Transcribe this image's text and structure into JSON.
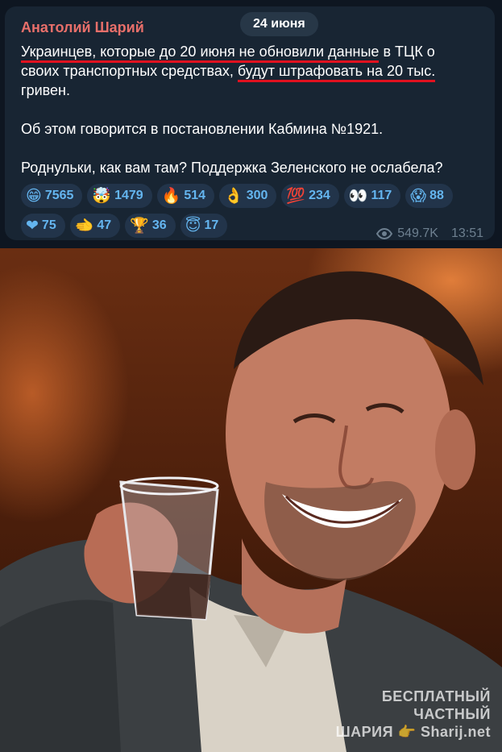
{
  "post": {
    "date": "24 июня",
    "author": "Анатолий Шарий",
    "text": {
      "l1_u1": "Украинцев, которые до 20 июня не обновили данные",
      "l1_rest": " в ТЦК о",
      "l2_pre": "своих транспортных средствах, ",
      "l2_u2": "будут штрафовать на 20 тыс.",
      "l3": "гривен.",
      "p2": "Об этом говорится в постановлении Кабмина №1921.",
      "p3": "Роднульки, как вам там? Поддержка Зеленского не ослабела?"
    },
    "reactions": [
      {
        "emoji": "😁",
        "count": "7565",
        "icon": "grin-emoji"
      },
      {
        "emoji": "🤯",
        "count": "1479",
        "icon": "exploding-head-emoji"
      },
      {
        "emoji": "🔥",
        "count": "514",
        "icon": "fire-emoji"
      },
      {
        "emoji": "👌",
        "count": "300",
        "icon": "ok-hand-emoji"
      },
      {
        "emoji": "💯",
        "count": "234",
        "icon": "hundred-emoji"
      },
      {
        "emoji": "👀",
        "count": "117",
        "icon": "eyes-emoji"
      },
      {
        "emoji": "😱",
        "count": "88",
        "icon": "scream-emoji"
      },
      {
        "emoji": "❤",
        "count": "75",
        "icon": "heart-emoji"
      },
      {
        "emoji": "🫲",
        "count": "47",
        "icon": "hand-emoji"
      },
      {
        "emoji": "🏆",
        "count": "36",
        "icon": "trophy-emoji"
      },
      {
        "emoji": "😇",
        "count": "17",
        "icon": "halo-emoji"
      }
    ],
    "views": "549.7K",
    "time": "13:51"
  },
  "photo": {
    "watermark_line1": "БЕСПЛАТНЫЙ ЧАСТНЫЙ",
    "watermark_line2": "ШАРИЯ 👉 Sharij.net"
  },
  "colors": {
    "background": "#0e1621",
    "card": "#182533",
    "author": "#e86f6a",
    "underline": "#e0111f",
    "reaction_text": "#64b5ef",
    "meta": "#6d7f8f"
  }
}
